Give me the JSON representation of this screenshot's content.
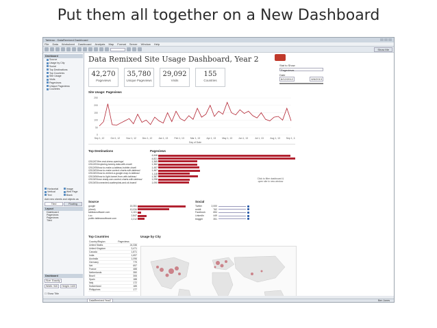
{
  "slide_title": "Put them all together on a New Dashboard",
  "window": {
    "title": "Tableau - DataRemixed Dashboard"
  },
  "menu": [
    "File",
    "Data",
    "Worksheet",
    "Dashboard",
    "Analysis",
    "Map",
    "Format",
    "Server",
    "Window",
    "Help"
  ],
  "toolbar": {
    "show_me": "Show Me"
  },
  "sidebar": {
    "dashboard_header": "Dashboard",
    "sheets": [
      "Source",
      "Usage by City",
      "Social",
      "Top Destinations",
      "Top Countries",
      "Site Usage",
      "Visits",
      "Pageviews",
      "Unique Pageviews",
      "Countries"
    ],
    "objects": [
      "Horizontal",
      "Image",
      "Vertical",
      "Web Page",
      "Text",
      "Blank"
    ],
    "add_text": "Add new sheets and objects as",
    "tiled": "Tiled",
    "floating": "Floating",
    "layout_header": "Layout",
    "layout_items": [
      "Dashboard",
      "Pageviews",
      "Pageviews",
      "Tiled"
    ],
    "size_header": "Dashboard",
    "size_mode": "Size: Exactly",
    "width": "Width: 940",
    "height": "Height: 1100",
    "show_title": "Show Title"
  },
  "dashboard": {
    "title": "Data Remixed Site Usage Dashboard, Year 2",
    "kpis": [
      {
        "value": "42,270",
        "label": "Pageviews"
      },
      {
        "value": "35,780",
        "label": "Unique Pageviews"
      },
      {
        "value": "29,092",
        "label": "Visits"
      },
      {
        "value": "155",
        "label": "Countries"
      }
    ],
    "control_label": "Stat to Show",
    "control_value": "Pageviews",
    "date_label": "Date",
    "date_from": "8/12/2012",
    "date_to": "8/6/2013",
    "site_usage_title": "Site Usage: Pageviews",
    "top_dest_title": "Top Destinations",
    "pageviews_col": "Pageviews",
    "note": "Click to filter dashboard & open site in new window",
    "source_title": "Source",
    "social_title": "Social",
    "top_countries_title": "Top Countries",
    "pageviews_col2": "Pageviews",
    "country_col": "Country/Region",
    "usage_city_title": "Usage by City"
  },
  "tabs": {
    "active": "DataRemixed Year2"
  },
  "status": {
    "user": "Ben Jones"
  },
  "colors": {
    "accent": "#b22230",
    "link_blue": "#2a5aa8"
  },
  "chart_data": [
    {
      "type": "line",
      "title": "Site Usage: Pageviews",
      "xlabel": "Day of Date",
      "x": [
        "Sep 1, 12",
        "Oct 1, 12",
        "Nov 1, 12",
        "Dec 1, 12",
        "Jan 1, 13",
        "Feb 1, 13",
        "Mar 1, 13",
        "Apr 1, 13",
        "May 1, 13",
        "Jun 1, 13",
        "Jul 1, 13",
        "Aug 1, 13",
        "Sep 1, 13"
      ],
      "yticks": [
        "250",
        "200",
        "150",
        "100",
        "50",
        "0"
      ],
      "ylim": [
        0,
        250
      ],
      "series_values": [
        60,
        90,
        210,
        70,
        65,
        80,
        95,
        110,
        75,
        140,
        85,
        100,
        70,
        120,
        95,
        80,
        150,
        90,
        160,
        110,
        95,
        130,
        105,
        180,
        120,
        140,
        200,
        125,
        160,
        140,
        220,
        150,
        135,
        170,
        145,
        160,
        130,
        115,
        150,
        105,
        95,
        120,
        125,
        100,
        180,
        95
      ]
    },
    {
      "type": "bar",
      "title": "Top Destinations",
      "categories": [
        "",
        "",
        "/2012/07/the-real-chess-openings/",
        "/2012/02/exploring-tammy-data-with-excel/",
        "/2012/05/how-to-make-a-tableau-bubble-chart/",
        "/2013/03/how-to-make-control-charts-with-tableau/",
        "/2013/02/how-to-embed-a-google-map-in-tableau/",
        "/2013/06/how-to-light-tunnel-from-with-tableau/",
        "/2013/03/use-ready-own-control-charts-with-tableau/",
        "/2013/03/connected-scatterplots-and-sit-board/"
      ],
      "values": [
        4646,
        4821,
        1369,
        1362,
        1457,
        1467,
        1118,
        1387,
        1098,
        1090
      ],
      "labels": [
        "4,646",
        "4,821",
        "1,369",
        "1,362",
        "1,457",
        "1,467",
        "1,118",
        "1,387",
        "1,098",
        "1,090"
      ]
    },
    {
      "type": "bar",
      "title": "Source",
      "categories": [
        "google",
        "(direct)",
        "tableausoftware.com",
        "t.co",
        "public.tableausoftware.com"
      ],
      "values": [
        15351,
        10034,
        1101,
        2847,
        2212
      ],
      "labels": [
        "15,351",
        "10,034",
        "1,101",
        "2,847",
        "2,212"
      ]
    },
    {
      "type": "table",
      "title": "Social",
      "rows": [
        {
          "name": "Twitter",
          "count": "2,000"
        },
        {
          "name": "reddit",
          "count": "762"
        },
        {
          "name": "Facebook",
          "count": "654"
        },
        {
          "name": "LinkedIn",
          "count": "449"
        },
        {
          "name": "blogger",
          "count": "351"
        }
      ]
    },
    {
      "type": "table",
      "title": "Top Countries",
      "rows": [
        {
          "country": "United States",
          "value": "24,336"
        },
        {
          "country": "United Kingdom",
          "value": "3,471"
        },
        {
          "country": "Canada",
          "value": "1,871"
        },
        {
          "country": "India",
          "value": "1,697"
        },
        {
          "country": "Australia",
          "value": "1,096"
        },
        {
          "country": "Germany",
          "value": "779"
        },
        {
          "country": "Net",
          "value": "697"
        },
        {
          "country": "France",
          "value": "488"
        },
        {
          "country": "Netherlands",
          "value": "350"
        },
        {
          "country": "Brazil",
          "value": "306"
        },
        {
          "country": "Spain",
          "value": "188"
        },
        {
          "country": "Italy",
          "value": "172"
        },
        {
          "country": "Switzerland",
          "value": "185"
        },
        {
          "country": "Philippines",
          "value": "177"
        }
      ]
    }
  ]
}
